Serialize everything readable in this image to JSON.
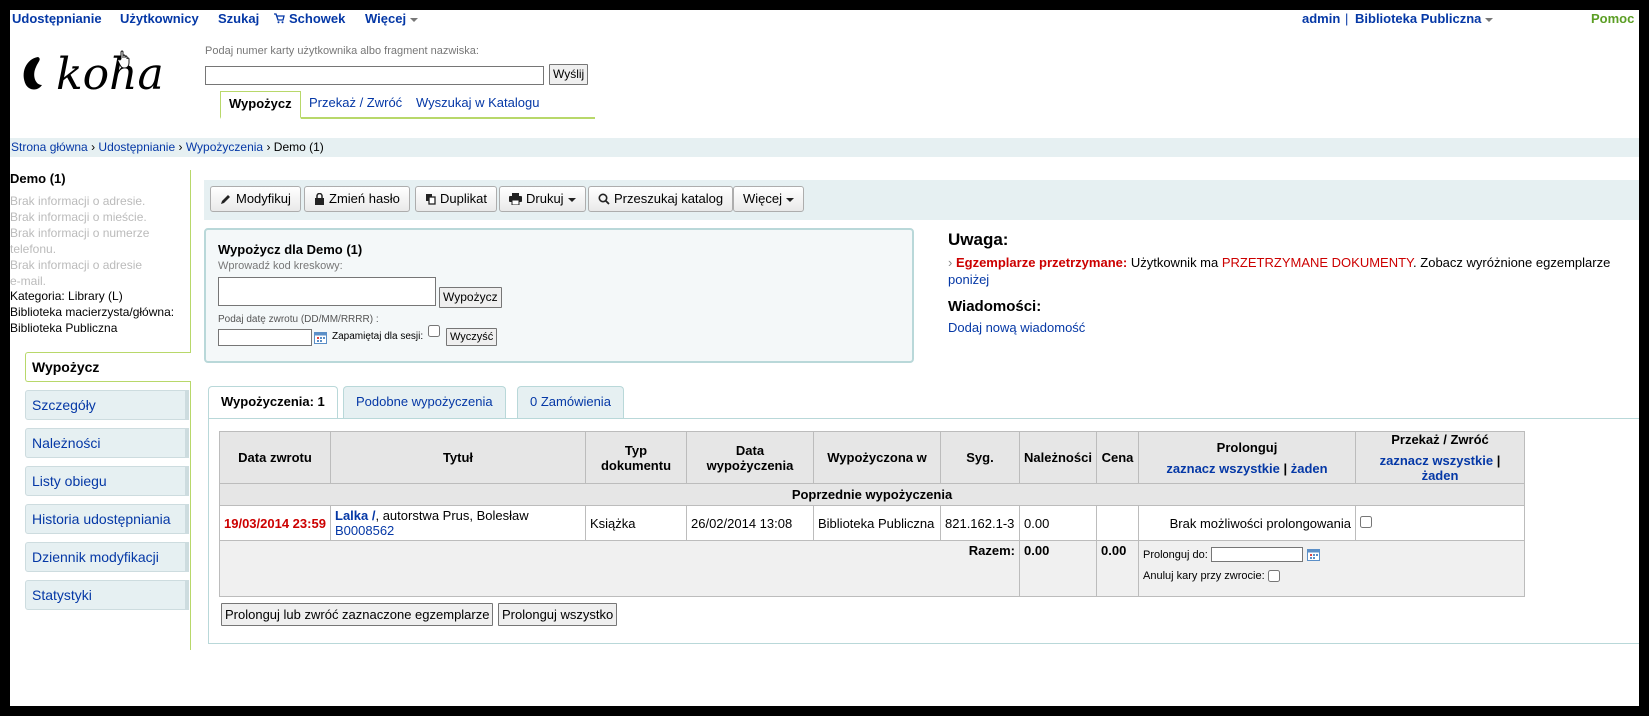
{
  "topnav": {
    "items": [
      "Udostępnianie",
      "Użytkownicy",
      "Szukaj",
      "Schowek",
      "Więcej"
    ],
    "user": "admin",
    "separator": "|",
    "library": "Biblioteka Publiczna",
    "help": "Pomoc"
  },
  "logo_text": "koha",
  "search": {
    "label": "Podaj numer karty użytkownika albo fragment nazwiska:",
    "value": "",
    "submit": "Wyślij"
  },
  "top_tabs": [
    "Wypożycz",
    "Przekaż / Zwróć",
    "Wyszukaj w Katalogu"
  ],
  "breadcrumb": [
    "Strona główna",
    "Udostępnianie",
    "Wypożyczenia",
    "Demo (1)"
  ],
  "breadcrumb_sep": "›",
  "patron": {
    "name": "Demo (1)",
    "no_address": "Brak informacji o adresie.",
    "no_city": "Brak informacji o mieście.",
    "no_phone_1": "Brak informacji o numerze",
    "no_phone_2": "telefonu.",
    "no_email_1": "Brak informacji o adresie",
    "no_email_2": "e-mail.",
    "category": "Kategoria: Library (L)",
    "home_library_label": "Biblioteka macierzysta/główna:",
    "home_library": "Biblioteka Publiczna"
  },
  "sidebar": [
    "Wypożycz",
    "Szczegóły",
    "Należności",
    "Listy obiegu",
    "Historia udostępniania",
    "Dziennik modyfikacji",
    "Statystyki"
  ],
  "toolbar": [
    "Modyfikuj",
    "Zmień hasło",
    "Duplikat",
    "Drukuj",
    "Przeszukaj katalog",
    "Więcej"
  ],
  "checkout": {
    "title": "Wypożycz dla Demo (1)",
    "barcode_label": "Wprowadź kod kreskowy:",
    "barcode_value": "",
    "submit": "Wypożycz",
    "due_label": "Podaj datę zwrotu (DD/MM/RRRR) :",
    "remember": "Zapamiętaj dla sesji:",
    "clear": "Wyczyść"
  },
  "attention": {
    "title": "Uwaga:",
    "bullet": "›",
    "label": "Egzemplarze przetrzymane:",
    "text1": "Użytkownik ma",
    "highlight": "PRZETRZYMANE DOKUMENTY",
    "text2": ". Zobacz wyróżnione egzemplarze",
    "link": "poniżej"
  },
  "messages": {
    "title": "Wiadomości:",
    "add_link": "Dodaj nową wiadomość"
  },
  "bottom_tabs": [
    "Wypożyczenia: 1",
    "Podobne wypożyczenia",
    "0 Zamówienia"
  ],
  "table": {
    "headers": [
      "Data zwrotu",
      "Tytuł",
      "Typ dokumentu",
      "Data wypożyczenia",
      "Wypożyczona w",
      "Syg.",
      "Należności",
      "Cena"
    ],
    "renew_header": "Prolonguj",
    "return_header": "Przekaż / Zwróć",
    "select_all": "zaznacz wszystkie",
    "pipe": "|",
    "none": "żaden",
    "group_label": "Poprzednie wypożyczenia",
    "row": {
      "due": "19/03/2014 23:59",
      "title": "Lalka /",
      "author": ", autorstwa Prus, Bolesław",
      "barcode": "B0008562",
      "type": "Książka",
      "checkout_date": "26/02/2014 13:08",
      "library": "Biblioteka Publiczna",
      "callno": "821.162.1-3",
      "fines": "0.00",
      "price": "",
      "renew": "Brak możliwości prolongowania"
    },
    "total_label": "Razem:",
    "total_fines": "0.00",
    "total_price": "0.00",
    "renew_to": "Prolonguj do:",
    "cancel_fines": "Anuluj kary przy zwrocie:"
  },
  "actions": {
    "renew_or_return": "Prolonguj lub zwróć zaznaczone egzemplarze",
    "renew_all": "Prolonguj wszystko"
  }
}
